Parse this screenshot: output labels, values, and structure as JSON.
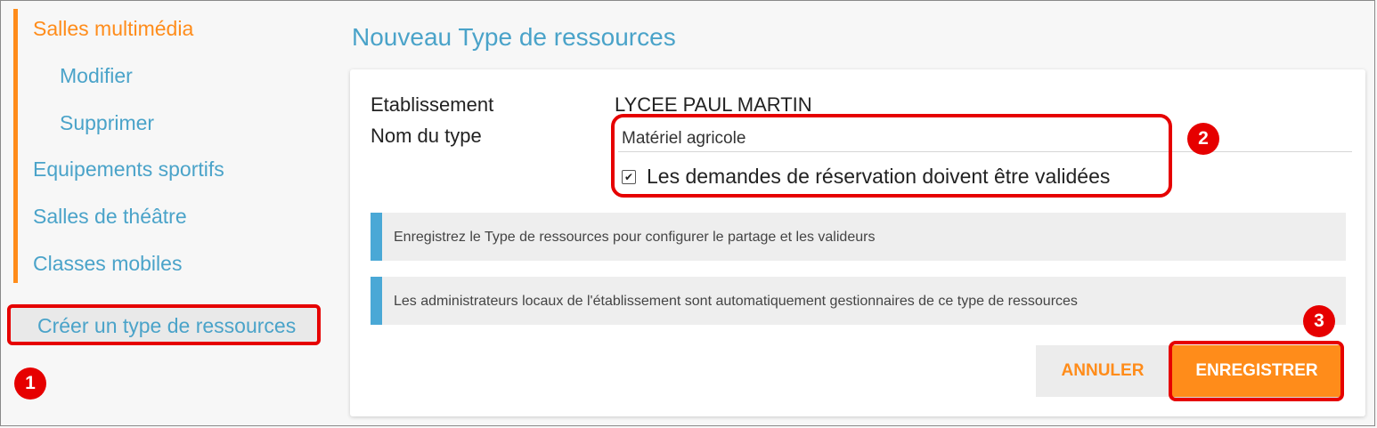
{
  "sidebar": {
    "items": [
      {
        "label": "Salles multimédia",
        "active": true
      },
      {
        "label": "Modifier"
      },
      {
        "label": "Supprimer"
      },
      {
        "label": "Equipements sportifs"
      },
      {
        "label": "Salles de théâtre"
      },
      {
        "label": "Classes mobiles"
      }
    ],
    "create_label": "Créer un type de ressources"
  },
  "markers": [
    "1",
    "2",
    "3"
  ],
  "main": {
    "title": "Nouveau Type de ressources",
    "form": {
      "etablissement_label": "Etablissement",
      "etablissement_value": "LYCEE PAUL MARTIN",
      "type_name_label": "Nom du type",
      "type_name_value": "Matériel agricole",
      "validation_checkbox_label": "Les demandes de réservation doivent être validées",
      "validation_checked": true
    },
    "notes": [
      "Enregistrez le Type de ressources pour configurer le partage et les valideurs",
      "Les administrateurs locaux de l'établissement sont automatiquement gestionnaires de ce type de ressources"
    ],
    "buttons": {
      "cancel": "ANNULER",
      "save": "ENREGISTRER"
    }
  },
  "colors": {
    "accent": "#ff8c1a",
    "link": "#4aa3c9",
    "highlight": "#e60000",
    "info_bar": "#4aa8d6"
  }
}
